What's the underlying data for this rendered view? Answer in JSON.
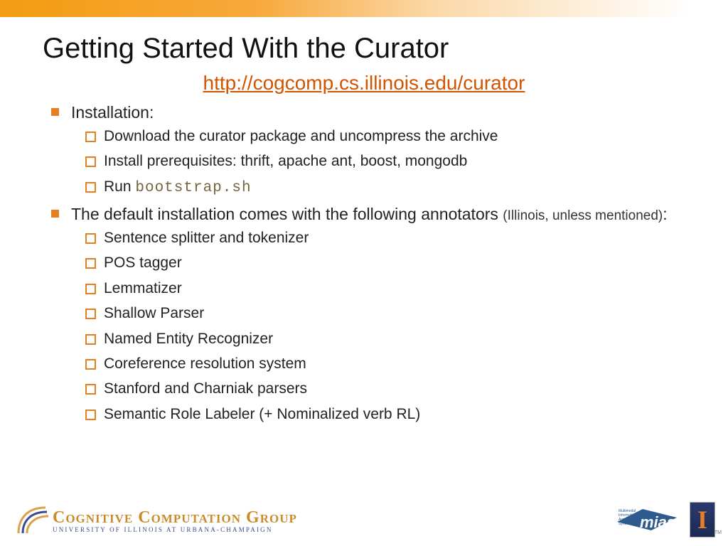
{
  "title": "Getting Started With the Curator",
  "link_text": "http://cogcomp.cs.illinois.edu/curator",
  "bullets": {
    "b1": {
      "text": "Installation:",
      "sub": [
        "Download the curator package and uncompress the archive",
        "Install prerequisites: thrift, apache ant, boost, mongodb"
      ],
      "run_prefix": "Run ",
      "run_code": "bootstrap.sh"
    },
    "b2": {
      "text_main": "The default installation comes with the following annotators ",
      "text_paren": "(Illinois, unless mentioned)",
      "text_colon": ":",
      "sub": [
        "Sentence splitter and tokenizer",
        "POS tagger",
        "Lemmatizer",
        "Shallow Parser",
        "Named Entity Recognizer",
        "Coreference resolution system",
        "Stanford and Charniak parsers",
        "Semantic Role Labeler (+ Nominalized verb RL)"
      ]
    }
  },
  "footer": {
    "ccg_main": "Cognitive Computation Group",
    "ccg_sub": "University of Illinois at Urbana-Champaign",
    "mias_label1": "Multimodal",
    "mias_label2": "Information",
    "mias_label3": "Access &",
    "mias_label4": "Synthesis",
    "mias_big": "mias",
    "ill_letter": "I",
    "tm": "TM"
  }
}
